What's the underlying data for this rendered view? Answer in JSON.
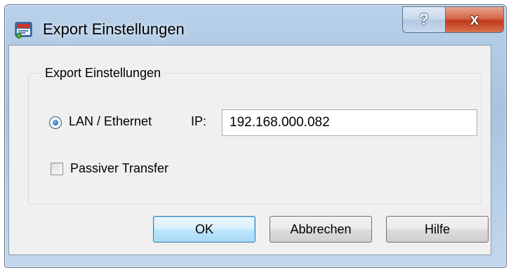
{
  "window": {
    "title": "Export Einstellungen",
    "help_glyph": "?",
    "close_glyph": "x"
  },
  "group": {
    "title": "Export Einstellungen"
  },
  "lan": {
    "label": "LAN / Ethernet",
    "selected": true
  },
  "ip": {
    "label": "IP:",
    "value": "192.168.000.082"
  },
  "passive": {
    "label": "Passiver Transfer",
    "checked": false
  },
  "buttons": {
    "ok": "OK",
    "cancel": "Abbrechen",
    "help": "Hilfe"
  },
  "colors": {
    "titlebar": "#b9d1ea",
    "close_button": "#c2391b",
    "client_background": "#f0f0f0",
    "default_button_border": "#3c7fb1"
  },
  "icons": {
    "app": "application-icon",
    "help": "help-icon",
    "close": "close-icon"
  }
}
